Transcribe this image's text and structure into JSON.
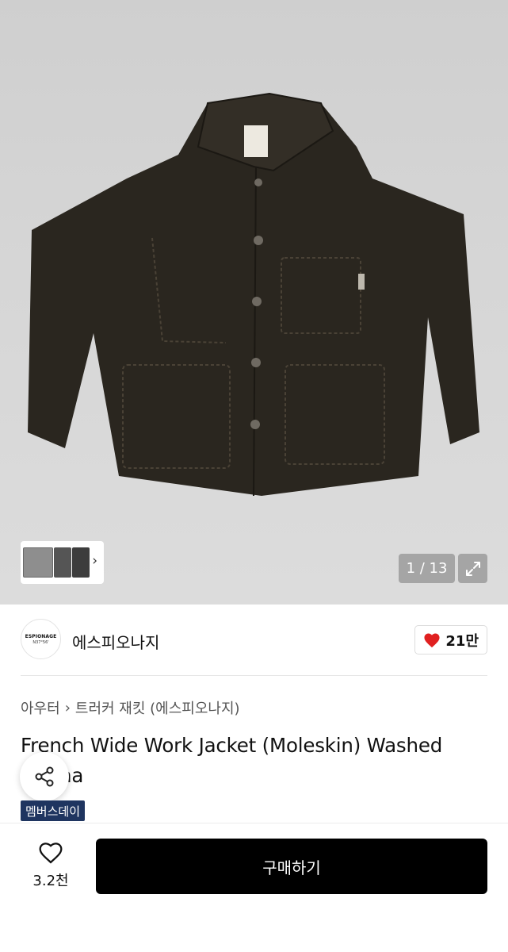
{
  "gallery": {
    "pager": "1 / 13",
    "expand_icon": "expand-arrows-icon",
    "thumb_chevron_icon": "chevron-right-icon"
  },
  "brand": {
    "logo_line1": "ESPIONAGE",
    "logo_line2": "N37°56'",
    "name": "에스피오나지",
    "like_count": "21만",
    "like_color": "#e02020"
  },
  "breadcrumb": {
    "category": "아우터",
    "subcategory": "트러커 재킷 (에스피오나지)"
  },
  "product": {
    "title": "French Wide Work Jacket (Moleskin) Washed Mocha",
    "badge": "멤버스데이",
    "badge_color": "#1f3560"
  },
  "bottom_bar": {
    "wish_count": "3.2천",
    "buy_label": "구매하기"
  }
}
